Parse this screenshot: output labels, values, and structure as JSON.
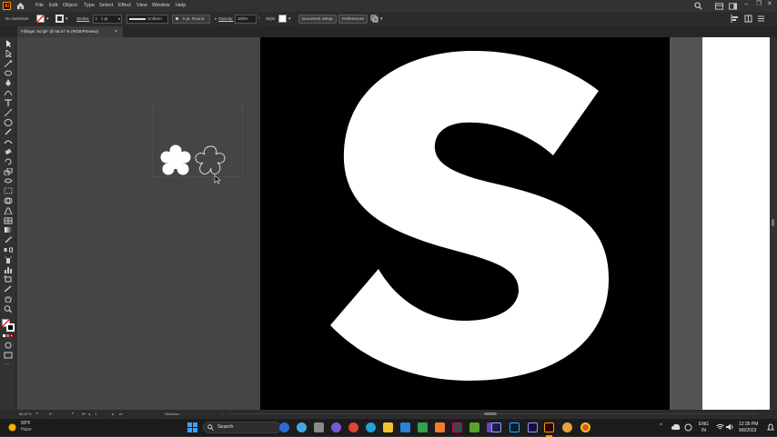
{
  "app": {
    "logo": "Ai",
    "menus": [
      "File",
      "Edit",
      "Object",
      "Type",
      "Select",
      "Effect",
      "View",
      "Window",
      "Help"
    ]
  },
  "control_bar": {
    "selection_state": "No Selection",
    "stroke_label": "Stroke:",
    "stroke_weight": "1 pt",
    "stroke_profile": "Uniform",
    "brush": "5 pt. Round",
    "opacity_label": "Opacity:",
    "opacity_value": "100%",
    "style_label": "Style:",
    "document_setup": "Document Setup",
    "preferences": "Preferences"
  },
  "document_tab": {
    "title": "Fillinger Script* @ 66.67 % (RGB/Preview)",
    "close": "×"
  },
  "status_bar": {
    "zoom": "66.67%",
    "rotation": "0°",
    "artboard_number": "1",
    "tool": "Selection"
  },
  "artboard": {
    "letter": "S"
  },
  "taskbar": {
    "weather_temp": "93°F",
    "weather_desc": "Haze",
    "search_label": "Search",
    "language": "ENG",
    "region": "IN",
    "time": "12:35 PM",
    "date": "9/8/2023"
  },
  "colors": {
    "ui_bg": "#323232",
    "pasteboard": "#454545",
    "canvas_gray": "#535353",
    "artboard_black": "#000000",
    "ai_orange": "#ff9a00"
  }
}
